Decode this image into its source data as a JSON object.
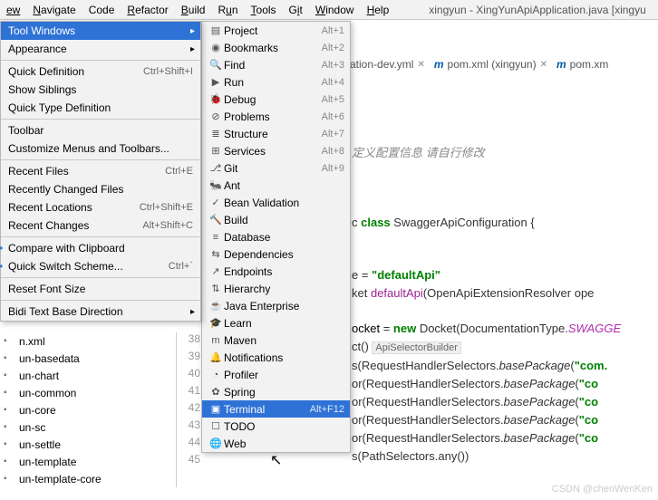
{
  "menubar": {
    "items": [
      "ew",
      "Navigate",
      "Code",
      "Refactor",
      "Build",
      "Run",
      "Tools",
      "Git",
      "Window",
      "Help"
    ],
    "title": "xingyun - XingYunApiApplication.java [xingyu"
  },
  "view_menu": [
    {
      "label": "Tool Windows",
      "shortcut": "",
      "sub": true,
      "selected": true
    },
    {
      "label": "Appearance",
      "shortcut": "",
      "sub": true
    },
    {
      "sep": true
    },
    {
      "label": "Quick Definition",
      "shortcut": "Ctrl+Shift+I"
    },
    {
      "label": "Show Siblings"
    },
    {
      "label": "Quick Type Definition"
    },
    {
      "sep": true
    },
    {
      "label": "Toolbar"
    },
    {
      "label": "Customize Menus and Toolbars..."
    },
    {
      "sep": true
    },
    {
      "label": "Recent Files",
      "shortcut": "Ctrl+E"
    },
    {
      "label": "Recently Changed Files"
    },
    {
      "label": "Recent Locations",
      "shortcut": "Ctrl+Shift+E"
    },
    {
      "label": "Recent Changes",
      "shortcut": "Alt+Shift+C"
    },
    {
      "sep": true
    },
    {
      "label": "Compare with Clipboard",
      "mark": true
    },
    {
      "label": "Quick Switch Scheme...",
      "shortcut": "Ctrl+`",
      "mark": true
    },
    {
      "sep": true
    },
    {
      "label": "Reset Font Size"
    },
    {
      "sep": true
    },
    {
      "label": "Bidi Text Base Direction",
      "sub": true
    }
  ],
  "tool_windows": [
    {
      "icon": "▤",
      "label": "Project",
      "sc": "Alt+1"
    },
    {
      "icon": "◉",
      "label": "Bookmarks",
      "sc": "Alt+2"
    },
    {
      "icon": "🔍",
      "label": "Find",
      "sc": "Alt+3"
    },
    {
      "icon": "▶",
      "label": "Run",
      "sc": "Alt+4"
    },
    {
      "icon": "🐞",
      "label": "Debug",
      "sc": "Alt+5"
    },
    {
      "icon": "⊘",
      "label": "Problems",
      "sc": "Alt+6"
    },
    {
      "icon": "≣",
      "label": "Structure",
      "sc": "Alt+7"
    },
    {
      "icon": "⊞",
      "label": "Services",
      "sc": "Alt+8"
    },
    {
      "icon": "⎇",
      "label": "Git",
      "sc": "Alt+9"
    },
    {
      "icon": "🐜",
      "label": "Ant"
    },
    {
      "icon": "✓",
      "label": "Bean Validation"
    },
    {
      "icon": "🔨",
      "label": "Build"
    },
    {
      "icon": "≡",
      "label": "Database"
    },
    {
      "icon": "⇆",
      "label": "Dependencies"
    },
    {
      "icon": "↗",
      "label": "Endpoints"
    },
    {
      "icon": "⇅",
      "label": "Hierarchy"
    },
    {
      "icon": "☕",
      "label": "Java Enterprise"
    },
    {
      "icon": "🎓",
      "label": "Learn"
    },
    {
      "icon": "m",
      "label": "Maven"
    },
    {
      "icon": "🔔",
      "label": "Notifications"
    },
    {
      "icon": "◔",
      "label": "Profiler"
    },
    {
      "icon": "✿",
      "label": "Spring"
    },
    {
      "icon": "▣",
      "label": "Terminal",
      "sc": "Alt+F12",
      "selected": true
    },
    {
      "icon": "☐",
      "label": "TODO"
    },
    {
      "icon": "🌐",
      "label": "Web"
    }
  ],
  "tabs": [
    {
      "icon": "",
      "label": "cation-dev.yml",
      "closable": true
    },
    {
      "icon": "m",
      "label": "pom.xml (xingyun)",
      "closable": true
    },
    {
      "icon": "m",
      "label": "pom.xm",
      "closable": false
    }
  ],
  "project_tree": [
    "n.xml",
    "un-basedata",
    "un-chart",
    "un-common",
    "un-core",
    "un-sc",
    "un-settle",
    "un-template",
    "un-template-core"
  ],
  "gutter": [
    "38",
    "39",
    "40",
    "41",
    "42",
    "43",
    "44",
    "45"
  ],
  "code": {
    "l1": "定义配置信息 请自行修改",
    "l2a": "c ",
    "l2b": "class",
    "l2c": " SwaggerApiConfiguration {",
    "l3a": "e = ",
    "l3b": "\"defaultApi\"",
    "l4a": "ket ",
    "l4b": "defaultApi",
    "l4c": "(OpenApiExtensionResolver ope",
    "l5a": "ocket",
    "l5b": " = ",
    "l5c": "new",
    "l5d": " Docket(DocumentationType.",
    "l5e": "SWAGGE",
    "l6a": "ct() ",
    "l6b": "ApiSelectorBuilder",
    "l7a": "s(RequestHandlerSelectors.",
    "l7b": "basePackage",
    "l7c": "(",
    "l7d": "\"com.",
    "l8a": "or(RequestHandlerSelectors.",
    "l8b": "basePackage",
    "l8c": "(",
    "l8d": "\"co",
    "l9a": "or(RequestHandlerSelectors.",
    "l9b": "basePackage",
    "l9c": "(",
    "l9d": "\"co",
    "l10a": "or(RequestHandlerSelectors.",
    "l10b": "basePackage",
    "l10c": "(",
    "l10d": "\"co",
    "l11a": "or(RequestHandlerSelectors.",
    "l11b": "basePackage",
    "l11c": "(",
    "l11d": "\"co",
    "l12": "s(PathSelectors.any())"
  },
  "watermark": "CSDN @chenWenKen"
}
